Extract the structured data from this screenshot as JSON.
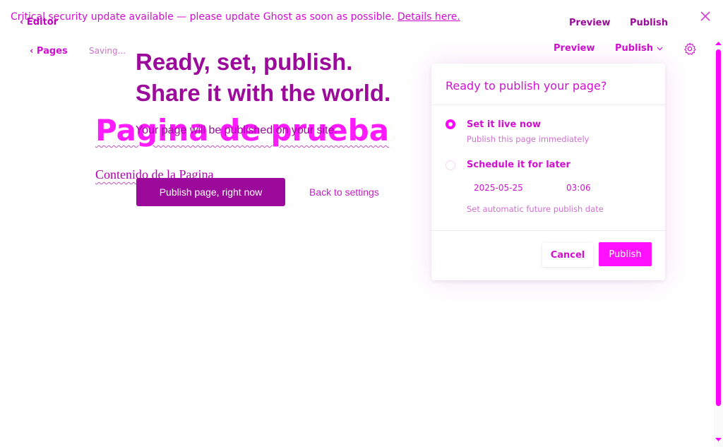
{
  "banner": {
    "text": "Critical security update available — please update Ghost as soon as possible.",
    "link": "Details here."
  },
  "header": {
    "back_label": "Editor",
    "preview_label": "Preview",
    "publish_label": "Publish"
  },
  "subheader": {
    "pages_label": "Pages",
    "status": "Saving...",
    "preview_label": "Preview",
    "publish_label": "Publish"
  },
  "page": {
    "title": "Pagina de prueba",
    "content": "Contenido de la Pagina"
  },
  "publish_flow": {
    "title_line1": "Ready, set, publish.",
    "title_line2": "Share it with the world.",
    "subtitle": "Your page will be published on your site.",
    "publish_now_button": "Publish page, right now",
    "back_link": "Back to settings"
  },
  "publish_menu": {
    "title": "Ready to publish your page?",
    "options": [
      {
        "label": "Set it live now",
        "description": "Publish this page immediately",
        "selected": true
      },
      {
        "label": "Schedule it for later",
        "description": "Set automatic future publish date",
        "selected": false
      }
    ],
    "date_value": "2025-05-25",
    "time_value": "03:06",
    "cancel_button": "Cancel",
    "confirm_button": "Publish"
  },
  "icons": {
    "close": "close-icon",
    "settings": "gear-icon",
    "chevron": "chevron-down-icon"
  },
  "colors": {
    "accent": "#ff00ff",
    "primary_dark": "#9b0a9b"
  }
}
